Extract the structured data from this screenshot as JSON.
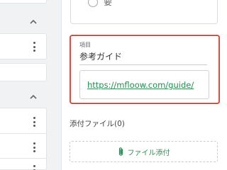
{
  "radio": {
    "label": "要"
  },
  "item": {
    "field_label": "項目",
    "value": "参考ガイド",
    "url": "https://mfloow.com/guide/"
  },
  "attachments": {
    "title": "添付ファイル(0)",
    "button_label": "ファイル添付"
  },
  "colors": {
    "highlight": "#e24a3b",
    "link": "#1f8f4e",
    "attach": "#2e8b57"
  },
  "icons": [
    "chevron-up-icon",
    "more-vert-icon",
    "radio-icon",
    "paperclip-icon"
  ]
}
